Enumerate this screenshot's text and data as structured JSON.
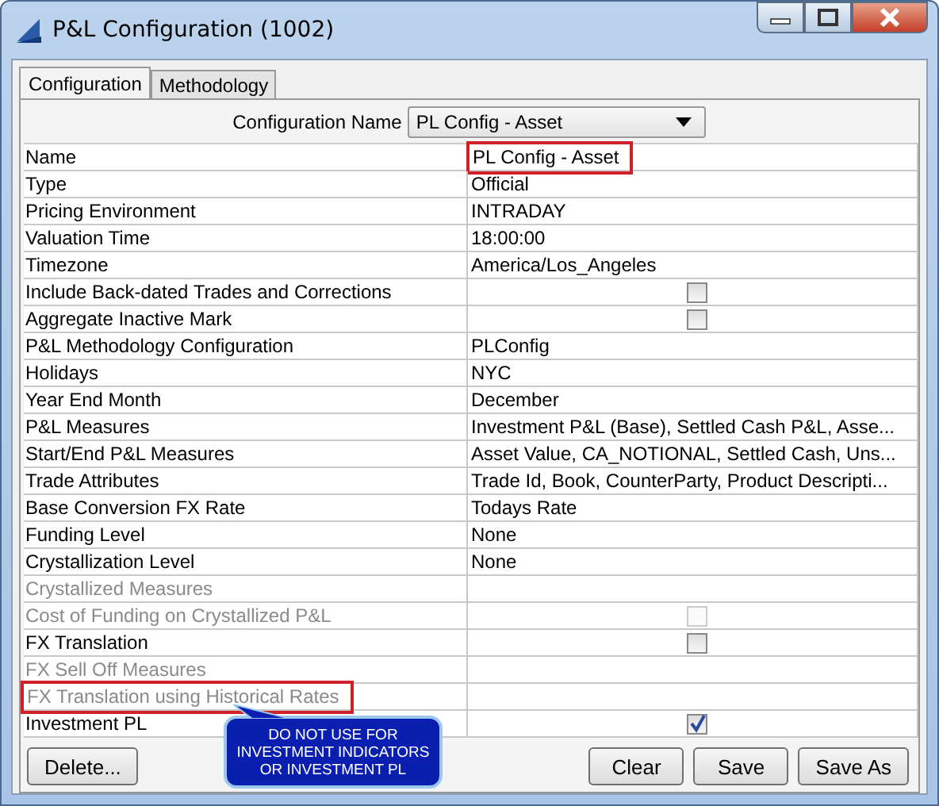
{
  "window": {
    "title": "P&L Configuration (1002)"
  },
  "tabs": [
    {
      "label": "Configuration",
      "selected": true
    },
    {
      "label": "Methodology",
      "selected": false
    }
  ],
  "config_name": {
    "label": "Configuration Name",
    "value": "PL Config - Asset"
  },
  "rows": [
    {
      "label": "Name",
      "kind": "text",
      "value": "PL Config - Asset",
      "disabled": false,
      "highlight_value": true
    },
    {
      "label": "Type",
      "kind": "text",
      "value": "Official",
      "disabled": false
    },
    {
      "label": "Pricing Environment",
      "kind": "text",
      "value": "INTRADAY",
      "disabled": false
    },
    {
      "label": "Valuation Time",
      "kind": "text",
      "value": "18:00:00",
      "disabled": false
    },
    {
      "label": "Timezone",
      "kind": "text",
      "value": "America/Los_Angeles",
      "disabled": false
    },
    {
      "label": "Include Back-dated Trades and Corrections",
      "kind": "checkbox",
      "disabled": false,
      "checked": false
    },
    {
      "label": "Aggregate Inactive Mark",
      "kind": "checkbox",
      "disabled": false,
      "checked": false
    },
    {
      "label": "P&L Methodology Configuration",
      "kind": "text",
      "value": "PLConfig",
      "disabled": false
    },
    {
      "label": "Holidays",
      "kind": "text",
      "value": "NYC",
      "disabled": false
    },
    {
      "label": "Year End Month",
      "kind": "text",
      "value": "December",
      "disabled": false
    },
    {
      "label": "P&L Measures",
      "kind": "text",
      "value": "Investment P&L (Base), Settled Cash P&L, Asse...",
      "disabled": false
    },
    {
      "label": "Start/End P&L Measures",
      "kind": "text",
      "value": "Asset Value, CA_NOTIONAL, Settled Cash, Uns...",
      "disabled": false
    },
    {
      "label": "Trade Attributes",
      "kind": "text",
      "value": "Trade Id, Book, CounterParty, Product Descripti...",
      "disabled": false
    },
    {
      "label": "Base Conversion FX Rate",
      "kind": "text",
      "value": "Todays Rate",
      "disabled": false
    },
    {
      "label": "Funding Level",
      "kind": "text",
      "value": "None",
      "disabled": false
    },
    {
      "label": "Crystallization Level",
      "kind": "text",
      "value": "None",
      "disabled": false
    },
    {
      "label": "Crystallized Measures",
      "kind": "empty",
      "disabled": true
    },
    {
      "label": "Cost of Funding on Crystallized P&L",
      "kind": "checkbox",
      "disabled": true,
      "checked": false
    },
    {
      "label": "FX Translation",
      "kind": "checkbox",
      "disabled": false,
      "checked": false
    },
    {
      "label": "FX Sell Off Measures",
      "kind": "empty",
      "disabled": true
    },
    {
      "label": "FX Translation using Historical Rates",
      "kind": "empty",
      "disabled": true,
      "highlight_label": true
    },
    {
      "label": "Investment PL",
      "kind": "checkbox",
      "disabled": false,
      "checked": true
    }
  ],
  "callout": {
    "text": "DO NOT USE FOR INVESTMENT INDICATORS OR INVESTMENT PL"
  },
  "buttons_left": [
    "Delete..."
  ],
  "buttons_right": [
    "Clear",
    "Save",
    "Save As"
  ]
}
